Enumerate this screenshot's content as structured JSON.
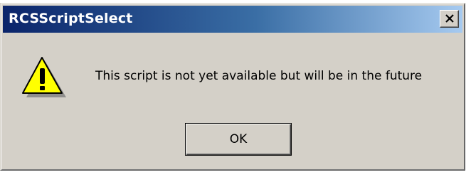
{
  "window": {
    "title": "RCSScriptSelect",
    "close_icon": "close-icon"
  },
  "dialog": {
    "icon": "warning-icon",
    "message": "This script is not yet available but will be in the future",
    "ok_label": "OK"
  },
  "colors": {
    "titlebar_start": "#0a246a",
    "titlebar_end": "#a6caf0",
    "face": "#d4d0c8",
    "warning_yellow": "#ffff00"
  }
}
